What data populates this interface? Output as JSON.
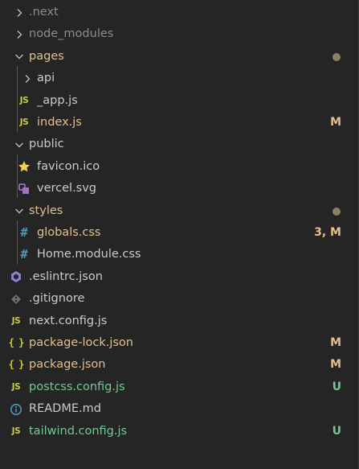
{
  "explorer": {
    "colors": {
      "background": "#252526",
      "default_text": "#cccccc",
      "dimmed_text": "#8c8c8c",
      "modified": "#e2c08d",
      "untracked": "#73c991",
      "js_icon": "#cbcb41",
      "css_icon": "#519aba",
      "json_icon": "#cbcb41",
      "info_icon": "#519aba",
      "dot": "#8b7f66"
    },
    "items": [
      {
        "label": ".next",
        "kind": "folder",
        "state": "collapsed",
        "color": "dimmed_text"
      },
      {
        "label": "node_modules",
        "kind": "folder",
        "state": "collapsed",
        "color": "dimmed_text"
      },
      {
        "label": "pages",
        "kind": "folder",
        "state": "expanded",
        "color": "modified",
        "badge": "dot"
      },
      {
        "label": "api",
        "kind": "folder",
        "state": "collapsed",
        "color": "default_text"
      },
      {
        "label": "_app.js",
        "kind": "file",
        "icon": "js-icon",
        "color": "default_text"
      },
      {
        "label": "index.js",
        "kind": "file",
        "icon": "js-icon",
        "color": "modified",
        "badge": "M"
      },
      {
        "label": "public",
        "kind": "folder",
        "state": "expanded",
        "color": "default_text"
      },
      {
        "label": "favicon.ico",
        "kind": "file",
        "icon": "star-icon",
        "color": "default_text"
      },
      {
        "label": "vercel.svg",
        "kind": "file",
        "icon": "svg-file-icon",
        "color": "default_text"
      },
      {
        "label": "styles",
        "kind": "folder",
        "state": "expanded",
        "color": "modified",
        "badge": "dot"
      },
      {
        "label": "globals.css",
        "kind": "file",
        "icon": "css-icon",
        "color": "modified",
        "badge": "3, M"
      },
      {
        "label": "Home.module.css",
        "kind": "file",
        "icon": "css-icon",
        "color": "default_text"
      },
      {
        "label": ".eslintrc.json",
        "kind": "file",
        "icon": "eslint-icon",
        "color": "default_text"
      },
      {
        "label": ".gitignore",
        "kind": "file",
        "icon": "git-icon",
        "color": "default_text"
      },
      {
        "label": "next.config.js",
        "kind": "file",
        "icon": "js-icon",
        "color": "default_text"
      },
      {
        "label": "package-lock.json",
        "kind": "file",
        "icon": "json-icon",
        "color": "modified",
        "badge": "M"
      },
      {
        "label": "package.json",
        "kind": "file",
        "icon": "json-icon",
        "color": "modified",
        "badge": "M"
      },
      {
        "label": "postcss.config.js",
        "kind": "file",
        "icon": "js-icon",
        "color": "untracked",
        "badge": "U"
      },
      {
        "label": "README.md",
        "kind": "file",
        "icon": "info-icon",
        "color": "default_text"
      },
      {
        "label": "tailwind.config.js",
        "kind": "file",
        "icon": "js-icon",
        "color": "untracked",
        "badge": "U"
      }
    ],
    "icon_text": {
      "js": "JS",
      "json": "{ }",
      "css": "#"
    }
  }
}
